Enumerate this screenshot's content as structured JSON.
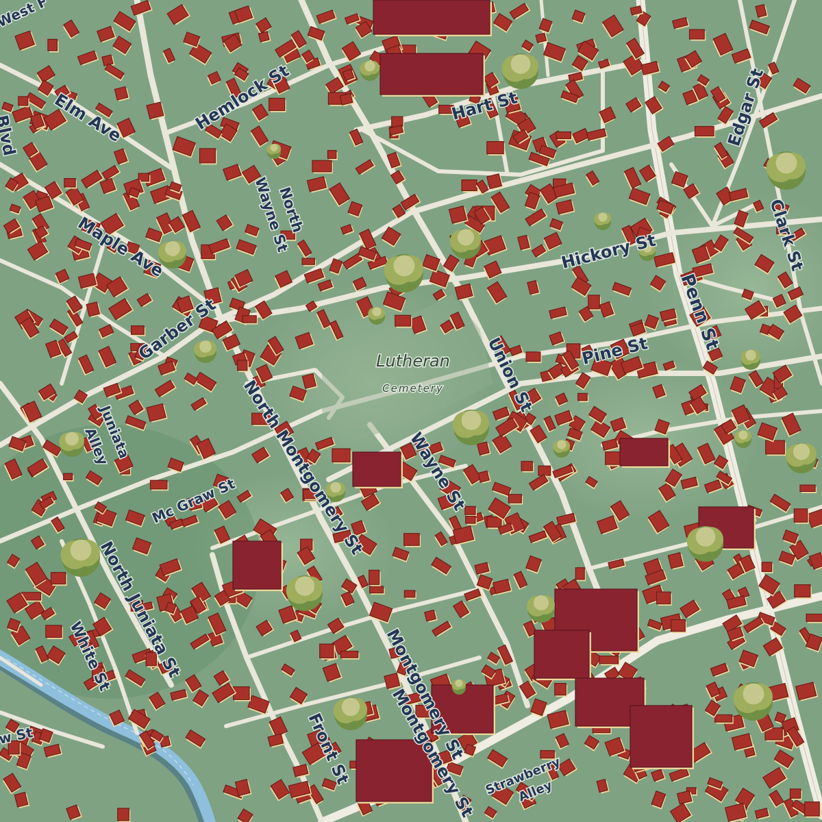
{
  "map": {
    "title": "",
    "colors": {
      "land": "#7fa283",
      "road": "#ece9de",
      "building": "#a8322a",
      "building_large": "#8a2330",
      "river": "#8ebfdc",
      "label_text": "#243654",
      "tree": "#9fae5c"
    },
    "area_labels": {
      "cemetery_name": "Lutheran",
      "cemetery_type": "Cemetery"
    },
    "street_labels": {
      "west": "West F",
      "elm_ave": "Elm Ave",
      "hemlock_st": "Hemlock St",
      "hart_st": "Hart St",
      "edgar_st": "Edgar St",
      "blvd": "Blvd",
      "north_wayne_1": "North",
      "north_wayne_2": "Wayne St",
      "maple_ave": "Maple Ave",
      "hickory_st": "Hickory St",
      "clark_st": "Clark St",
      "penn_st": "Penn St",
      "garber_st": "Garber St",
      "union_st": "Union St",
      "pine_st": "Pine St",
      "juniata_alley_1": "Juniata",
      "juniata_alley_2": "Alley",
      "north_montgomery_st": "North Montgomery St",
      "wayne_st": "Wayne St",
      "mc_graw_st": "Mc Graw St",
      "north_juniata_st": "North Juniata St",
      "white_st": "White St",
      "montgomery_st_upper": "Montgomery St",
      "montgomery_st_lower": "Montgomery St",
      "front_st": "Front St",
      "strawberry_alley_1": "Strawberry",
      "strawberry_alley_2": "Alley",
      "w_st": "w St"
    }
  }
}
